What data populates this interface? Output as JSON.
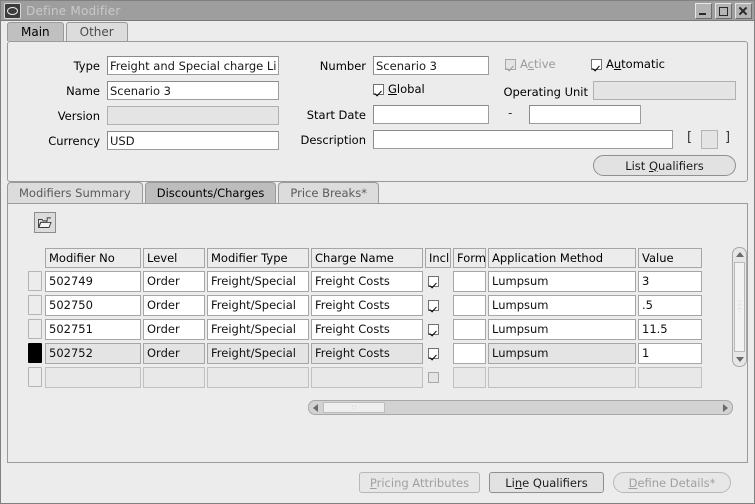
{
  "window": {
    "title": "Define Modifier",
    "app_icon": "oracle-logo-icon",
    "buttons": {
      "minimize": "minimize-icon",
      "maximize": "maximize-icon",
      "close": "close-icon"
    }
  },
  "top_tabs": [
    {
      "label": "Main",
      "selected": true
    },
    {
      "label": "Other",
      "selected": false
    }
  ],
  "header_form": {
    "type": {
      "label": "Type",
      "value": "Freight and Special charge Li"
    },
    "name": {
      "label": "Name",
      "value": "Scenario 3"
    },
    "version": {
      "label": "Version",
      "value": "",
      "disabled": true
    },
    "currency": {
      "label": "Currency",
      "value": "USD"
    },
    "number": {
      "label": "Number",
      "value": "Scenario 3"
    },
    "active": {
      "label": "Active",
      "mnemonic": "c",
      "checked": true,
      "disabled": true
    },
    "automatic": {
      "label": "Automatic",
      "mnemonic": "u",
      "checked": true,
      "disabled": false
    },
    "global": {
      "label": "Global",
      "mnemonic": "G",
      "checked": true,
      "disabled": false
    },
    "operating_unit": {
      "label": "Operating Unit",
      "value": "",
      "disabled": true
    },
    "start_date": {
      "label": "Start Date",
      "from": "",
      "to": "",
      "separator": "-"
    },
    "description": {
      "label": "Description",
      "value": "",
      "flex_open": "[",
      "flex_close": "]"
    },
    "list_qualifiers_button": {
      "pre": "List ",
      "mnemonic": "Q",
      "post": "ualifiers"
    }
  },
  "lower_tabs": [
    {
      "label": "Modifiers Summary",
      "selected": false
    },
    {
      "label": "Discounts/Charges",
      "selected": true
    },
    {
      "label": "Price Breaks*",
      "selected": false
    }
  ],
  "grid_toolbar": {
    "export_icon": "folder-open-export-icon"
  },
  "grid": {
    "columns": [
      "Modifier No",
      "Level",
      "Modifier Type",
      "Charge Name",
      "Inclu",
      "Formu",
      "Application Method",
      "Value"
    ],
    "rows": [
      {
        "modifier_no": "502749",
        "level": "Order",
        "modifier_type": "Freight/Special",
        "charge_name": "Freight Costs",
        "include": true,
        "formula": "",
        "application_method": "Lumpsum",
        "value": "3",
        "current": false,
        "empty": false
      },
      {
        "modifier_no": "502750",
        "level": "Order",
        "modifier_type": "Freight/Special",
        "charge_name": "Freight Costs",
        "include": true,
        "formula": "",
        "application_method": "Lumpsum",
        "value": ".5",
        "current": false,
        "empty": false
      },
      {
        "modifier_no": "502751",
        "level": "Order",
        "modifier_type": "Freight/Special",
        "charge_name": "Freight Costs",
        "include": true,
        "formula": "",
        "application_method": "Lumpsum",
        "value": "11.5",
        "current": false,
        "empty": false
      },
      {
        "modifier_no": "502752",
        "level": "Order",
        "modifier_type": "Freight/Special",
        "charge_name": "Freight Costs",
        "include": true,
        "formula": "",
        "application_method": "Lumpsum",
        "value": "1",
        "current": true,
        "empty": false
      },
      {
        "modifier_no": "",
        "level": "",
        "modifier_type": "",
        "charge_name": "",
        "include": false,
        "formula": "",
        "application_method": "",
        "value": "",
        "current": false,
        "empty": true
      }
    ]
  },
  "footer_buttons": {
    "pricing_attributes": {
      "pre": "",
      "mnemonic": "P",
      "post": "ricing Attributes",
      "disabled": true
    },
    "line_qualifiers": {
      "pre": "Li",
      "mnemonic": "n",
      "post": "e Qualifiers",
      "disabled": false
    },
    "define_details": {
      "pre": "",
      "mnemonic": "D",
      "post": "efine Details*",
      "disabled": true
    }
  },
  "colors": {
    "window_bg": "#ececec",
    "titlebar_bg": "#9e9e9e",
    "selected_tab": "#bdbdbd",
    "field_bg": "#ffffff",
    "disabled_bg": "#e4e4e4"
  }
}
